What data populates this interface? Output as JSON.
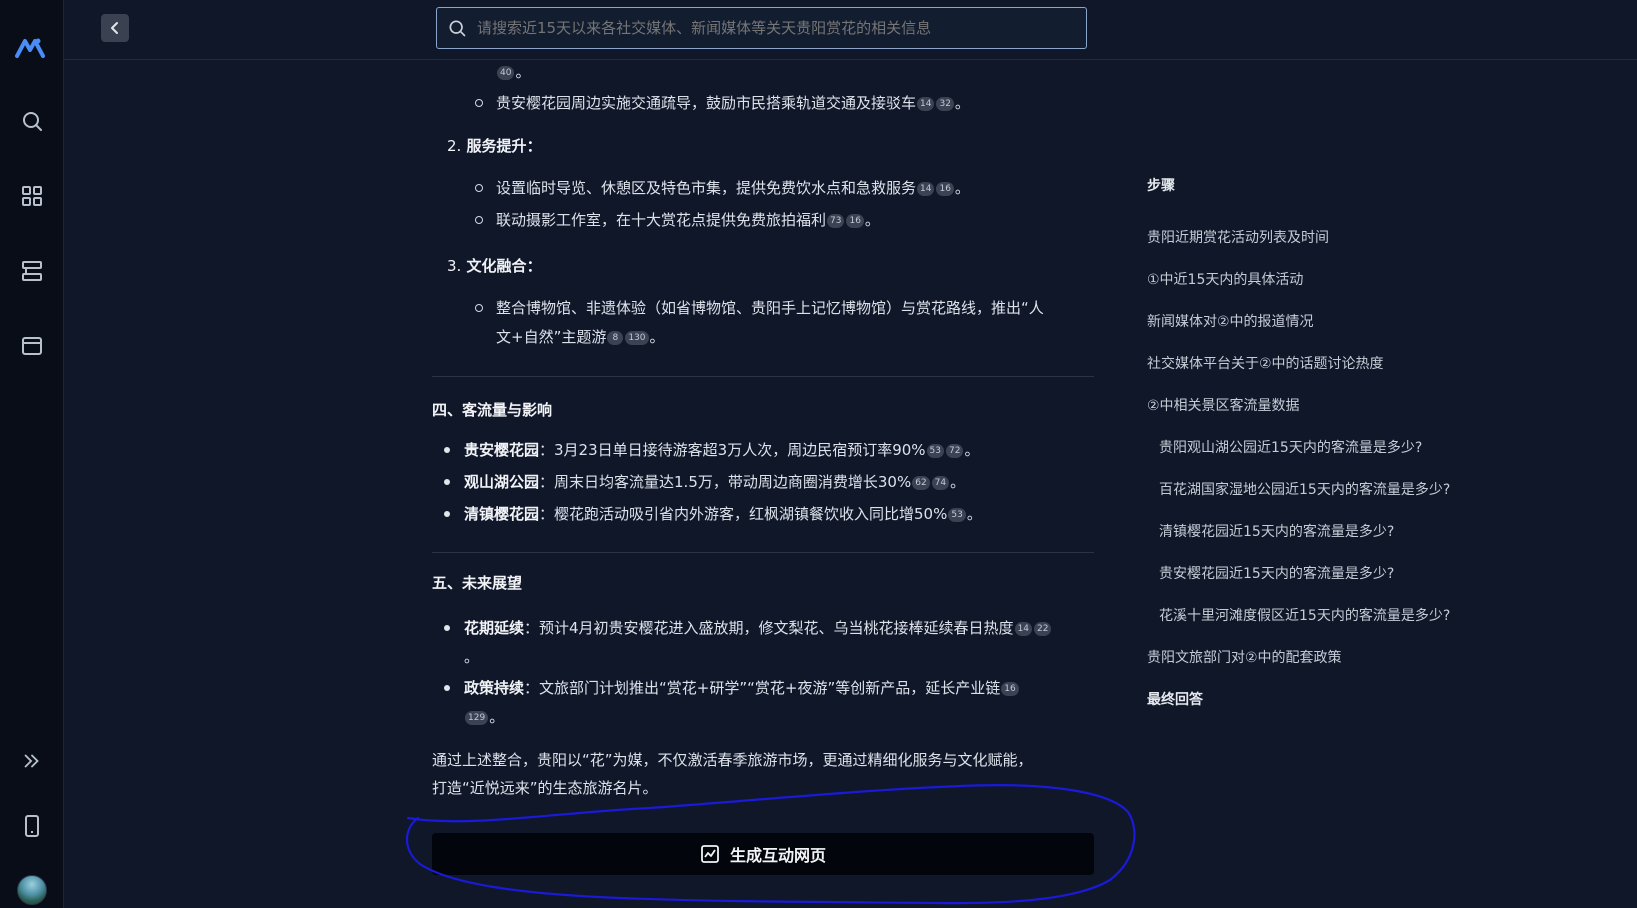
{
  "search": {
    "placeholder": "请搜索近15天以来各社交媒体、新闻媒体等关天贵阳赏花的相关信息"
  },
  "article": {
    "frag_cite": "40",
    "frag_tail": "。",
    "b1": {
      "text": "贵安樱花园周边实施交通疏导，鼓励市民搭乘轨道交通及接驳车",
      "cites": [
        "14",
        "32"
      ],
      "tail": "。"
    },
    "sec2": {
      "num": "2.",
      "title": "服务提升",
      "colon": "："
    },
    "b2": {
      "text": "设置临时导览、休憩区及特色市集，提供免费饮水点和急救服务",
      "cites": [
        "14",
        "16"
      ],
      "tail": "。"
    },
    "b3": {
      "text": "联动摄影工作室，在十大赏花点提供免费旅拍福利",
      "cites": [
        "73",
        "16"
      ],
      "tail": "。"
    },
    "sec3": {
      "num": "3.",
      "title": "文化融合",
      "colon": "："
    },
    "b4": {
      "line1": "整合博物馆、非遗体验（如省博物馆、贵阳手上记忆博物馆）与赏花路线，推出“人",
      "line2": "文+自然”主题游",
      "cites": [
        "8",
        "130"
      ],
      "tail": "。"
    },
    "h4": "四、客流量与影响",
    "flow": [
      {
        "name": "贵安樱花园",
        "text": "：3月23日单日接待游客超3万人次，周边民宿预订率90%",
        "cites": [
          "53",
          "72"
        ],
        "tail": "。"
      },
      {
        "name": "观山湖公园",
        "text": "：周末日均客流量达1.5万，带动周边商圈消费增长30%",
        "cites": [
          "62",
          "74"
        ],
        "tail": "。"
      },
      {
        "name": "清镇樱花园",
        "text": "：樱花跑活动吸引省内外游客，红枫湖镇餐饮收入同比增50%",
        "cites": [
          "53"
        ],
        "tail": "。"
      }
    ],
    "h5": "五、未来展望",
    "f1": {
      "name": "花期延续",
      "text": "：预计4月初贵安樱花进入盛放期，修文梨花、乌当桃花接棒延续春日热度",
      "cites": [
        "14",
        "22"
      ],
      "line2": "。"
    },
    "f2": {
      "name": "政策持续",
      "text": "：文旅部门计划推出“赏花+研学”“赏花+夜游”等创新产品，延长产业链",
      "cites": [
        "16"
      ],
      "cite2": "129",
      "line2": "。"
    },
    "summary1": "通过上述整合，贵阳以“花”为媒，不仅激活春季旅游市场，更通过精细化服务与文化赋能，",
    "summary2": "打造“近悦远来”的生态旅游名片。",
    "gen_button": "生成互动网页"
  },
  "toc": {
    "title": "步骤",
    "items": [
      "贵阳近期赏花活动列表及时间",
      "①中近15天内的具体活动",
      "新闻媒体对②中的报道情况",
      "社交媒体平台关于②中的话题讨论热度",
      "②中相关景区客流量数据",
      "贵阳观山湖公园近15天内的客流量是多少?",
      "百花湖国家湿地公园近15天内的客流量是多少?",
      "清镇樱花园近15天内的客流量是多少?",
      "贵安樱花园近15天内的客流量是多少?",
      "花溪十里河滩度假区近15天内的客流量是多少?",
      "贵阳文旅部门对②中的配套政策"
    ],
    "final": "最终回答"
  },
  "colors": {
    "background": "#0f1729",
    "sidebar": "#080d18",
    "annotation": "#1a1ad8",
    "button": "#02050b"
  },
  "icons": [
    "logo-icon",
    "search-icon",
    "apps-grid-icon",
    "stack-icon",
    "window-icon",
    "expand-icon",
    "mobile-icon",
    "back-icon",
    "chart-icon"
  ]
}
